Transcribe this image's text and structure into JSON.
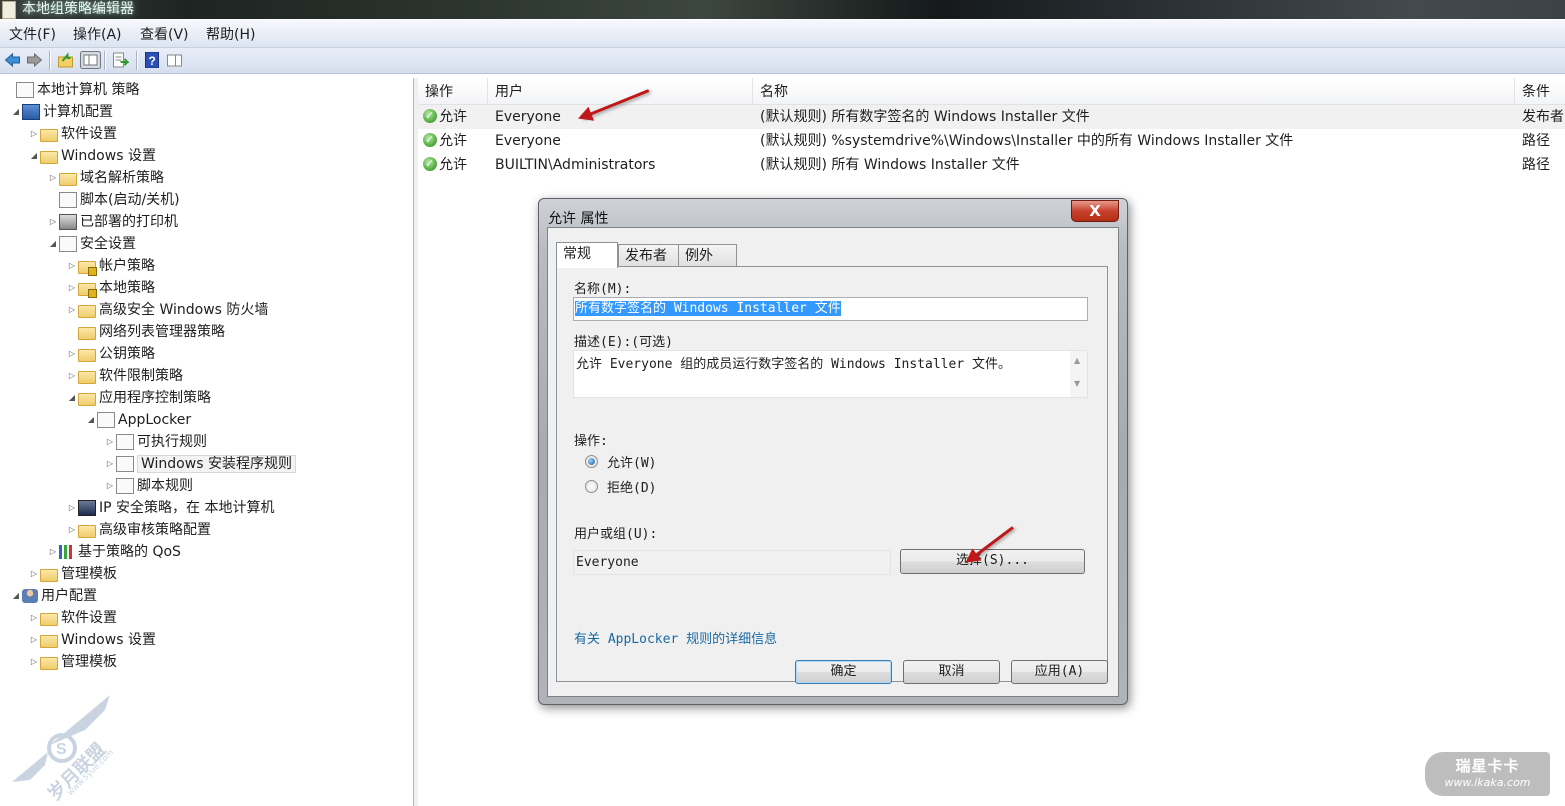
{
  "window": {
    "title": "本地组策略编辑器"
  },
  "menu": [
    {
      "label": "文件(F)"
    },
    {
      "label": "操作(A)"
    },
    {
      "label": "查看(V)"
    },
    {
      "label": "帮助(H)"
    }
  ],
  "toolbar": {
    "buttons": [
      {
        "icon": "back-arrow-icon"
      },
      {
        "icon": "forward-arrow-icon"
      },
      {
        "icon": "up-folder-icon"
      },
      {
        "icon": "show-hide-console-tree-icon"
      },
      {
        "icon": "export-list-icon"
      },
      {
        "icon": "help-icon"
      },
      {
        "icon": "show-hide-action-pane-icon"
      }
    ]
  },
  "tree": {
    "items": [
      {
        "label": "本地计算机 策略",
        "level": 0,
        "expander": "",
        "icon": "policy-document-icon"
      },
      {
        "label": "计算机配置",
        "level": 1,
        "expander": "expanded",
        "icon": "computer-icon"
      },
      {
        "label": "软件设置",
        "level": 2,
        "expander": "collapsed",
        "icon": "folder-icon"
      },
      {
        "label": "Windows 设置",
        "level": 2,
        "expander": "expanded",
        "icon": "folder-icon"
      },
      {
        "label": "域名解析策略",
        "level": 3,
        "expander": "collapsed",
        "icon": "folder-icon"
      },
      {
        "label": "脚本(启动/关机)",
        "level": 3,
        "expander": "",
        "icon": "script-icon"
      },
      {
        "label": "已部署的打印机",
        "level": 3,
        "expander": "collapsed",
        "icon": "printer-icon"
      },
      {
        "label": "安全设置",
        "level": 3,
        "expander": "expanded",
        "icon": "security-settings-icon"
      },
      {
        "label": "帐户策略",
        "level": 4,
        "expander": "collapsed",
        "icon": "locked-folder-icon"
      },
      {
        "label": "本地策略",
        "level": 4,
        "expander": "collapsed",
        "icon": "locked-folder-icon"
      },
      {
        "label": "高级安全 Windows 防火墙",
        "level": 4,
        "expander": "collapsed",
        "icon": "folder-icon"
      },
      {
        "label": "网络列表管理器策略",
        "level": 4,
        "expander": "",
        "icon": "folder-icon"
      },
      {
        "label": "公钥策略",
        "level": 4,
        "expander": "collapsed",
        "icon": "folder-icon"
      },
      {
        "label": "软件限制策略",
        "level": 4,
        "expander": "collapsed",
        "icon": "folder-icon"
      },
      {
        "label": "应用程序控制策略",
        "level": 4,
        "expander": "expanded",
        "icon": "folder-icon"
      },
      {
        "label": "AppLocker",
        "level": 5,
        "expander": "expanded",
        "icon": "applocker-icon"
      },
      {
        "label": "可执行规则",
        "level": 6,
        "expander": "collapsed",
        "icon": "rules-table-icon"
      },
      {
        "label": "Windows 安装程序规则",
        "level": 6,
        "expander": "collapsed",
        "icon": "installer-rules-icon",
        "selected": true
      },
      {
        "label": "脚本规则",
        "level": 6,
        "expander": "collapsed",
        "icon": "script-rules-icon"
      },
      {
        "label": "IP 安全策略，在 本地计算机",
        "level": 4,
        "expander": "collapsed",
        "icon": "ip-security-icon"
      },
      {
        "label": "高级审核策略配置",
        "level": 4,
        "expander": "collapsed",
        "icon": "folder-icon"
      },
      {
        "label": "基于策略的 QoS",
        "level": 3,
        "expander": "collapsed",
        "icon": "qos-chart-icon"
      },
      {
        "label": "管理模板",
        "level": 2,
        "expander": "collapsed",
        "icon": "folder-icon"
      },
      {
        "label": "用户配置",
        "level": 1,
        "expander": "expanded",
        "icon": "user-icon"
      },
      {
        "label": "软件设置",
        "level": 2,
        "expander": "collapsed",
        "icon": "folder-icon"
      },
      {
        "label": "Windows 设置",
        "level": 2,
        "expander": "collapsed",
        "icon": "folder-icon"
      },
      {
        "label": "管理模板",
        "level": 2,
        "expander": "collapsed",
        "icon": "folder-icon"
      }
    ]
  },
  "list": {
    "columns": [
      {
        "label": "操作"
      },
      {
        "label": "用户"
      },
      {
        "label": "名称"
      },
      {
        "label": "条件"
      }
    ],
    "rows": [
      {
        "action": "允许",
        "user": "Everyone",
        "name": "(默认规则) 所有数字签名的 Windows Installer 文件",
        "condition": "发布者",
        "selected": true
      },
      {
        "action": "允许",
        "user": "Everyone",
        "name": "(默认规则) %systemdrive%\\Windows\\Installer 中的所有 Windows Installer 文件",
        "condition": "路径"
      },
      {
        "action": "允许",
        "user": "BUILTIN\\Administrators",
        "name": "(默认规则) 所有 Windows Installer 文件",
        "condition": "路径"
      }
    ]
  },
  "dialog": {
    "title": "允许 属性",
    "close_label": "X",
    "tabs": [
      {
        "label": "常规",
        "active": true
      },
      {
        "label": "发布者"
      },
      {
        "label": "例外"
      }
    ],
    "name_label": "名称(M):",
    "name_value": "所有数字签名的 Windows Installer 文件",
    "description_label": "描述(E):(可选)",
    "description_value": "允许 Everyone 组的成员运行数字签名的 Windows Installer 文件。",
    "action_label": "操作:",
    "action_options": [
      {
        "label": "允许(W)",
        "checked": true
      },
      {
        "label": "拒绝(D)",
        "checked": false
      }
    ],
    "user_group_label": "用户或组(U):",
    "user_group_value": "Everyone",
    "select_button": "选择(S)...",
    "help_link": "有关 AppLocker 规则的详细信息",
    "ok_button": "确定",
    "cancel_button": "取消",
    "apply_button": "应用(A)"
  },
  "watermarks": {
    "left_brand": "岁月联盟",
    "left_url": "www.5yue.com",
    "right_brand": "瑞星卡卡",
    "right_url": "www.ikaka.com"
  },
  "colors": {
    "selection": "#3399ff",
    "annotation_arrow": "#c01818",
    "link": "#1a6aa0",
    "close_button": "#c8412c"
  }
}
